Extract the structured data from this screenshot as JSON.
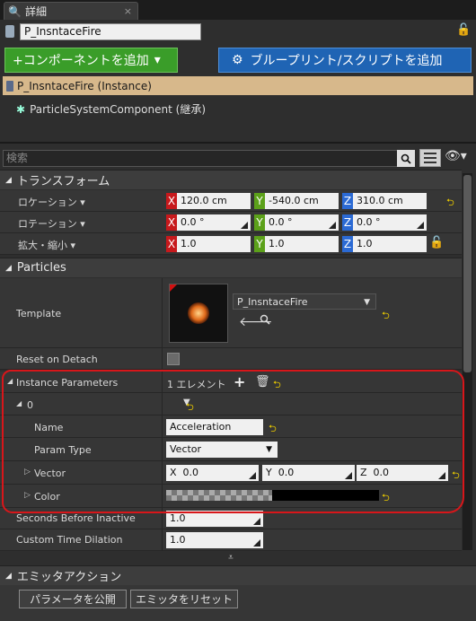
{
  "tab": {
    "title": "詳細",
    "close": "×"
  },
  "actor": {
    "name": "P_InsntaceFire"
  },
  "toolbar": {
    "add_component": "+コンポーネントを追加",
    "add_component_caret": "▾",
    "blueprint": "ブループリント/スクリプトを追加"
  },
  "components": {
    "root": "P_InsntaceFire (Instance)",
    "child": "ParticleSystemComponent (継承)"
  },
  "search": {
    "placeholder": "検索"
  },
  "transform": {
    "header": "トランスフォーム",
    "location": {
      "label": "ロケーション ▾",
      "x": "120.0 cm",
      "y": "-540.0 cm",
      "z": "310.0 cm"
    },
    "rotation": {
      "label": "ロテーション ▾",
      "x": "0.0 °",
      "y": "0.0 °",
      "z": "0.0 °"
    },
    "scale": {
      "label": "拡大・縮小 ▾",
      "x": "1.0",
      "y": "1.0",
      "z": "1.0"
    }
  },
  "axis": {
    "x": "X",
    "y": "Y",
    "z": "Z"
  },
  "particles": {
    "header": "Particles",
    "template_label": "Template",
    "template_value": "P_InsntaceFire",
    "reset_on_detach": "Reset on Detach",
    "instance_params": {
      "label": "Instance Parameters",
      "count": "1 エレメント"
    },
    "element": {
      "index": "0"
    },
    "name": {
      "label": "Name",
      "value": "Acceleration"
    },
    "param_type": {
      "label": "Param Type",
      "value": "Vector"
    },
    "vector": {
      "label": "Vector",
      "x_label": "X",
      "x": "0.0",
      "y_label": "Y",
      "y": "0.0",
      "z_label": "Z",
      "z": "0.0"
    },
    "color": {
      "label": "Color"
    },
    "seconds_before_inactive": {
      "label": "Seconds Before Inactive",
      "value": "1.0"
    },
    "custom_time_dilation": {
      "label": "Custom Time Dilation",
      "value": "1.0"
    }
  },
  "emitter": {
    "header": "エミッタアクション",
    "publish": "パラメータを公開",
    "reset": "エミッタをリセット"
  },
  "colors": {
    "accent_green": "#3a9d29",
    "accent_blue": "#1f64b4",
    "selection": "#d7b88b",
    "annotation_red": "#d8161a"
  }
}
